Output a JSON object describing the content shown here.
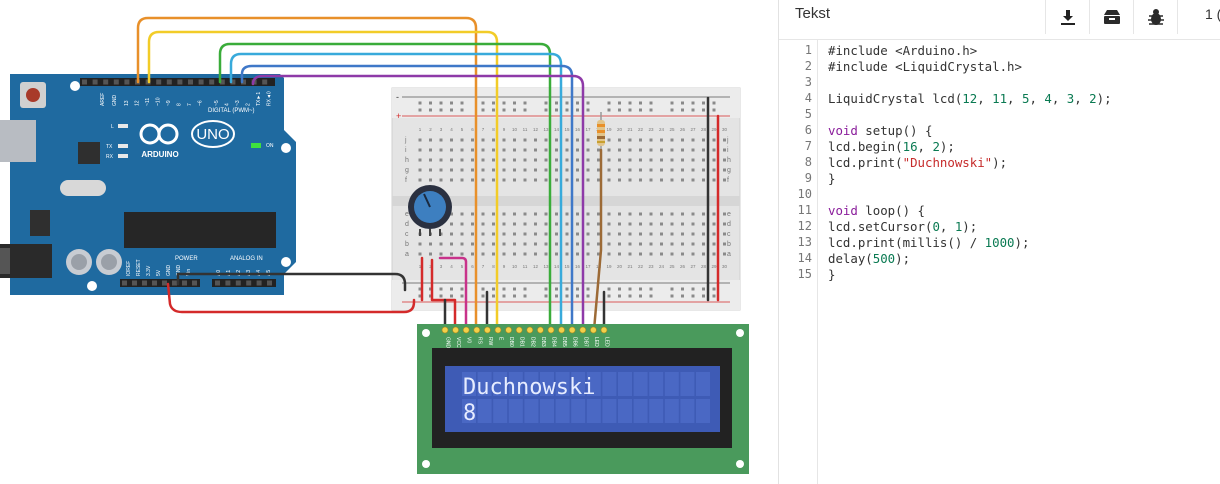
{
  "panel": {
    "title": "Tekst",
    "page_indicator": "1 (",
    "buttons": [
      {
        "name": "download-button",
        "icon": "download-icon"
      },
      {
        "name": "library-button",
        "icon": "library-icon"
      },
      {
        "name": "debug-button",
        "icon": "bug-icon"
      }
    ]
  },
  "code": {
    "lines": [
      "#include <Arduino.h>",
      "#include <LiquidCrystal.h>",
      "",
      "LiquidCrystal lcd(12, 11, 5, 4, 3, 2);",
      "",
      "void setup() {",
      "lcd.begin(16, 2);",
      "lcd.print(\"Duchnowski\");",
      "}",
      "",
      "void loop() {",
      "lcd.setCursor(0, 1);",
      "lcd.print(millis() / 1000);",
      "delay(500);",
      "}"
    ]
  },
  "circuit": {
    "arduino": {
      "brand": "ARDUINO",
      "model": "UNO",
      "digital_label": "DIGITAL (PWM~)",
      "power_label": "POWER",
      "analog_label": "ANALOG IN",
      "on_label": "ON",
      "l_label": "L",
      "tx_label": "TX",
      "rx_label": "RX",
      "aref_label": "AREF",
      "gnd_label": "GND",
      "top_pins": [
        "13",
        "12",
        "~11",
        "~10",
        "~9",
        "8",
        "7",
        "~6",
        "~5",
        "4",
        "~3",
        "2",
        "TX►1",
        "RX◄0"
      ],
      "power_pins": [
        "IOREF",
        "RESET",
        "3.3V",
        "5V",
        "GND",
        "GND",
        "Vin"
      ],
      "analog_pins": [
        "A0",
        "A1",
        "A2",
        "A3",
        "A4",
        "A5"
      ]
    },
    "lcd": {
      "line1": "Duchnowski",
      "line2": "8",
      "pins": [
        "GND",
        "VCC",
        "V0",
        "RS",
        "RW",
        "E",
        "DB0",
        "DB1",
        "DB2",
        "DB3",
        "DB4",
        "DB5",
        "DB6",
        "DB7",
        "LED",
        "LED"
      ]
    },
    "breadboard": {
      "row_letters_top": [
        "j",
        "i",
        "h",
        "g",
        "f"
      ],
      "row_letters_bottom": [
        "e",
        "d",
        "c",
        "b",
        "a"
      ],
      "column_numbers": [
        "1",
        "2",
        "3",
        "4",
        "5",
        "6",
        "7",
        "8",
        "9",
        "10",
        "11",
        "12",
        "13",
        "14",
        "15",
        "16",
        "17",
        "18",
        "19",
        "20",
        "21",
        "22",
        "23",
        "24",
        "25",
        "26",
        "27",
        "28",
        "29",
        "30"
      ],
      "plus_label": "+",
      "minus_label": "-"
    },
    "colors": {
      "arduino_blue": "#1f6aa0",
      "breadboard": "#e8e8e8",
      "lcd_board": "#4a9a5c",
      "lcd_screen": "#3e5bb5",
      "wire_orange": "#e8902a",
      "wire_yellow": "#f2cc28",
      "wire_green": "#3aac3a",
      "wire_cyan": "#38aadb",
      "wire_blue": "#3f78c8",
      "wire_purple": "#8e3aa8",
      "wire_red": "#d42a2a",
      "wire_black": "#333333",
      "wire_magenta": "#c8328a",
      "wire_brown": "#9c6a36"
    }
  }
}
